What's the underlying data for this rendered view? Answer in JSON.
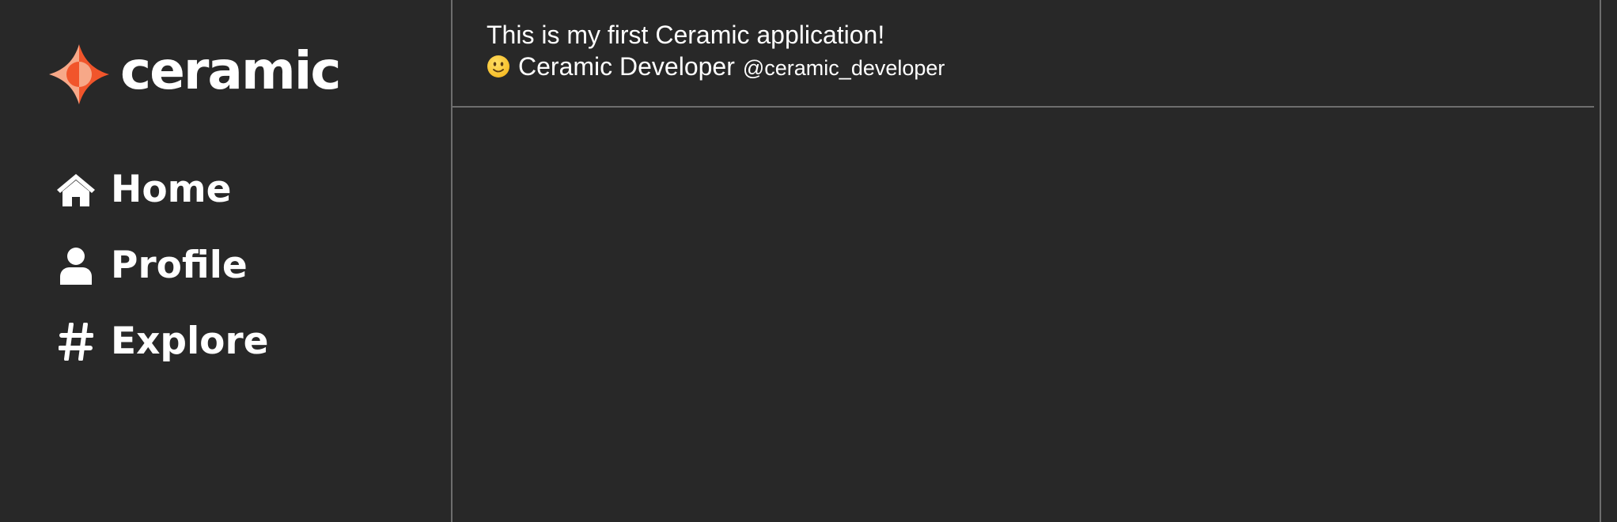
{
  "brand": {
    "name": "ceramic",
    "colors": {
      "orange": "#f1552b",
      "light_orange": "#f7a888",
      "background": "#282828",
      "divider": "#6e6e6e"
    }
  },
  "sidebar": {
    "items": [
      {
        "label": "Home",
        "icon": "home-icon"
      },
      {
        "label": "Profile",
        "icon": "user-icon"
      },
      {
        "label": "Explore",
        "icon": "hashtag-icon"
      }
    ]
  },
  "feed": {
    "posts": [
      {
        "text": "This is my first Ceramic application!",
        "author": {
          "emoji": "slightly-smiling-face-emoji",
          "name": "Ceramic Developer",
          "handle": "@ceramic_developer"
        }
      }
    ]
  }
}
